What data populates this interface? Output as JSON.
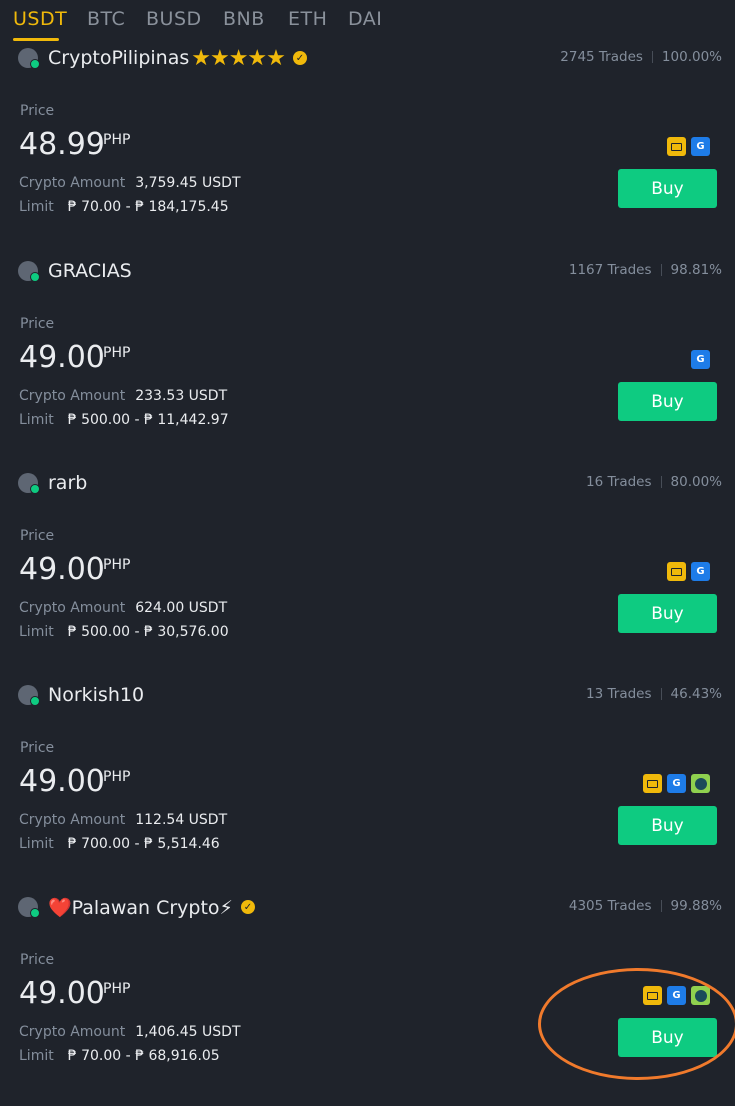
{
  "tabs": [
    "USDT",
    "BTC",
    "BUSD",
    "BNB",
    "ETH",
    "DAI"
  ],
  "labels": {
    "price": "Price",
    "crypto_amount": "Crypto Amount",
    "limit": "Limit",
    "buy": "Buy",
    "currency": "PHP"
  },
  "listings": [
    {
      "name": "CryptoPilipinas",
      "stars": "★★★★★",
      "verified": true,
      "trades": "2745 Trades",
      "completion": "100.00%",
      "price": "48.99",
      "amount": "3,759.45 USDT",
      "limit": "₱ 70.00 - ₱ 184,175.45",
      "payments": [
        "bank-card-icon",
        "gcash-icon"
      ]
    },
    {
      "name": "GRACIAS",
      "stars": "",
      "verified": false,
      "trades": "1167 Trades",
      "completion": "98.81%",
      "price": "49.00",
      "amount": "233.53 USDT",
      "limit": "₱ 500.00 - ₱ 11,442.97",
      "payments": [
        "gcash-icon"
      ]
    },
    {
      "name": "rarb",
      "stars": "",
      "verified": false,
      "trades": "16 Trades",
      "completion": "80.00%",
      "price": "49.00",
      "amount": "624.00 USDT",
      "limit": "₱ 500.00 - ₱ 30,576.00",
      "payments": [
        "bank-card-icon",
        "gcash-icon"
      ]
    },
    {
      "name": "Norkish10",
      "stars": "",
      "verified": false,
      "trades": "13 Trades",
      "completion": "46.43%",
      "price": "49.00",
      "amount": "112.54 USDT",
      "limit": "₱ 700.00 - ₱ 5,514.46",
      "payments": [
        "bank-card-icon",
        "gcash-icon",
        "paymaya-icon"
      ]
    },
    {
      "name": "❤️Palawan Crypto⚡",
      "stars": "",
      "verified": true,
      "trades": "4305 Trades",
      "completion": "99.88%",
      "price": "49.00",
      "amount": "1,406.45 USDT",
      "limit": "₱ 70.00 - ₱ 68,916.05",
      "payments": [
        "bank-card-icon",
        "gcash-icon",
        "paymaya-icon"
      ]
    }
  ],
  "colors": {
    "background": "#1f232b",
    "accent": "#f0b90b",
    "buy": "#0ecb81",
    "annotation": "#f07a2c"
  }
}
